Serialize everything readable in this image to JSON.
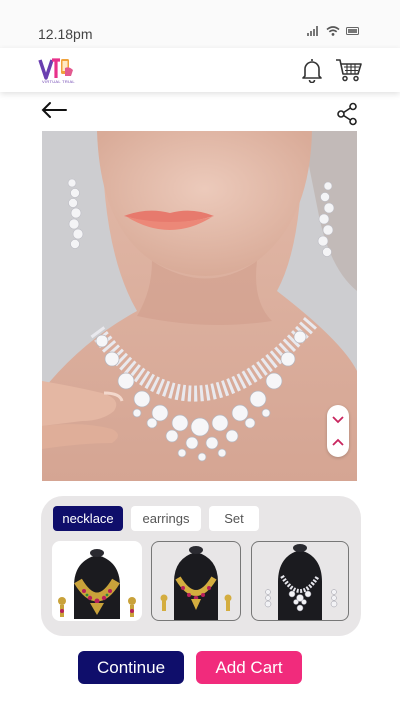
{
  "status_bar": {
    "time": "12.18pm"
  },
  "header": {
    "logo_text": "VIRTUAL TRIAL",
    "icons": [
      "bell-icon",
      "cart-icon"
    ]
  },
  "toolbar": {
    "icons": [
      "back-arrow-icon",
      "share-icon"
    ]
  },
  "preview": {
    "icons": [
      "chevron-down-icon",
      "chevron-up-icon"
    ]
  },
  "categories": {
    "tabs": [
      {
        "label": "necklace",
        "selected": true
      },
      {
        "label": "earrings",
        "selected": false
      },
      {
        "label": "Set",
        "selected": false
      }
    ]
  },
  "actions": {
    "continue_label": "Continue",
    "add_cart_label": "Add Cart"
  },
  "colors": {
    "primary_navy": "#0f0e6b",
    "accent_pink": "#f12b7c",
    "panel_bg": "#e8e6e7"
  }
}
